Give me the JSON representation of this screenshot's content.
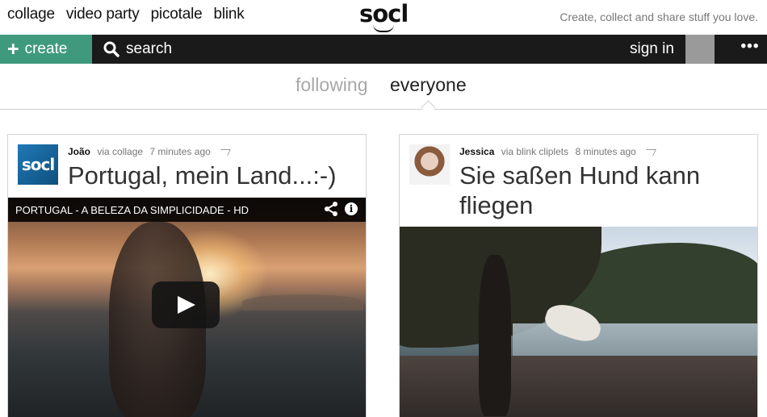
{
  "topnav": {
    "items": [
      {
        "label": "collage"
      },
      {
        "label": "video party"
      },
      {
        "label": "picotale"
      },
      {
        "label": "blink"
      }
    ],
    "logo": "socl",
    "tagline": "Create, collect and share stuff you love."
  },
  "cmdbar": {
    "create_label": "create",
    "search_label": "search",
    "signin_label": "sign in",
    "more_label": "•••"
  },
  "tabs": {
    "following": "following",
    "everyone": "everyone",
    "active": "everyone"
  },
  "posts": [
    {
      "author": "João",
      "via": "via collage",
      "time": "7 minutes ago",
      "title": "Portugal, mein Land...:-)",
      "avatar_text": "socl",
      "video_title": "PORTUGAL - A BELEZA DA SIMPLICIDADE - HD",
      "info_glyph": "i"
    },
    {
      "author": "Jessica",
      "via": "via blink cliplets",
      "time": "8 minutes ago",
      "title": "Sie saßen Hund kann fliegen"
    }
  ],
  "colors": {
    "create_green": "#3f9a7d",
    "command_bar": "#1a1a1a",
    "tab_inactive": "#a8a8a8"
  }
}
